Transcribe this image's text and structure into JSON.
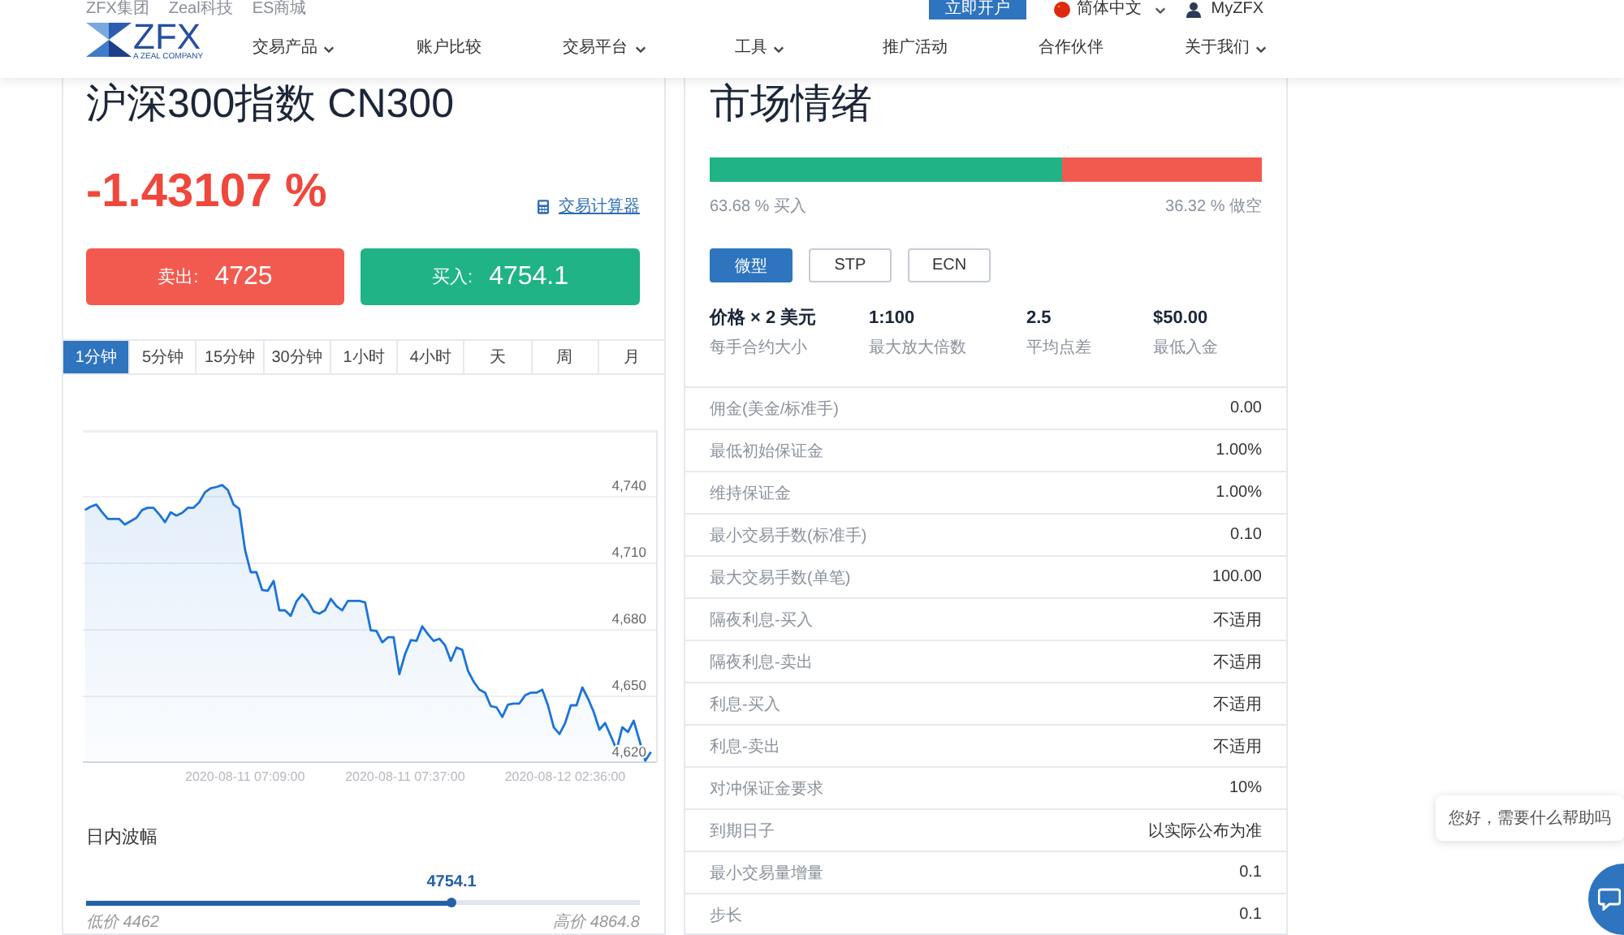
{
  "header": {
    "top_links": [
      "ZFX集团",
      "Zeal科技",
      "ES商城"
    ],
    "open_account_button": "立即开户",
    "language": "简体中文",
    "account_link": "MyZFX",
    "logo": {
      "text": "ZFX",
      "tagline": "A ZEAL COMPANY"
    },
    "nav": [
      {
        "label": "交易产品",
        "dropdown": true
      },
      {
        "label": "账户比较",
        "dropdown": false
      },
      {
        "label": "交易平台",
        "dropdown": true
      },
      {
        "label": "工具",
        "dropdown": true
      },
      {
        "label": "推广活动",
        "dropdown": false
      },
      {
        "label": "合作伙伴",
        "dropdown": false
      },
      {
        "label": "关于我们",
        "dropdown": true
      }
    ]
  },
  "instrument": {
    "title": "沪深300指数 CN300",
    "change": "-1.43107 %",
    "falling": true,
    "calculator_link": "交易计算器",
    "quotes": [
      {
        "kind": "sell",
        "label": "卖出:",
        "price": "4725"
      },
      {
        "kind": "buy",
        "label": "买入:",
        "price": "4754.1"
      }
    ],
    "timeframes": [
      {
        "label": "1分钟",
        "selected": true
      },
      {
        "label": "5分钟",
        "selected": false
      },
      {
        "label": "15分钟",
        "selected": false
      },
      {
        "label": "30分钟",
        "selected": false
      },
      {
        "label": "1小时",
        "selected": false
      },
      {
        "label": "4小时",
        "selected": false
      },
      {
        "label": "天",
        "selected": false
      },
      {
        "label": "周",
        "selected": false
      },
      {
        "label": "月",
        "selected": false
      }
    ],
    "chart_data": {
      "type": "area",
      "grid": true,
      "ylim": [
        4620,
        4770
      ],
      "yticks": [
        {
          "value": 4620,
          "label": "4,620"
        },
        {
          "value": 4650,
          "label": "4,650"
        },
        {
          "value": 4680,
          "label": "4,680"
        },
        {
          "value": 4710,
          "label": "4,710"
        },
        {
          "value": 4740,
          "label": "4,740"
        }
      ],
      "categories": [
        null,
        null,
        null,
        null,
        null,
        null,
        null,
        null,
        null,
        null,
        null,
        null,
        null,
        null,
        null,
        null,
        null,
        null,
        null,
        null,
        null,
        null,
        null,
        null,
        null,
        null,
        null,
        null,
        "2020-08-11 07:09:00",
        null,
        null,
        null,
        null,
        null,
        null,
        null,
        null,
        null,
        null,
        null,
        null,
        null,
        null,
        null,
        null,
        null,
        null,
        null,
        null,
        null,
        null,
        null,
        null,
        null,
        null,
        null,
        "2020-08-11 07:37:00",
        null,
        null,
        null,
        null,
        null,
        null,
        null,
        null,
        null,
        null,
        null,
        null,
        null,
        null,
        null,
        null,
        null,
        null,
        null,
        null,
        null,
        null,
        null,
        null,
        null,
        null,
        null,
        "2020-08-12 02:36:00",
        null,
        null,
        null,
        null,
        null,
        null,
        null,
        null,
        null,
        null,
        null,
        null,
        null,
        null,
        null
      ],
      "values": [
        4734,
        4735.5,
        4736.5,
        4733,
        4730,
        4730,
        4730,
        4727.5,
        4729,
        4730.5,
        4734,
        4735,
        4735,
        4732,
        4728.5,
        4733,
        4731.5,
        4732.7,
        4735,
        4735,
        4737.5,
        4742,
        4743.8,
        4744.4,
        4745.3,
        4743,
        4736.5,
        4734.6,
        4716,
        4706,
        4706,
        4698,
        4697.6,
        4702,
        4688.8,
        4688.8,
        4686.3,
        4692.7,
        4696,
        4693,
        4688.3,
        4687.3,
        4688.8,
        4694,
        4690.7,
        4688.8,
        4693,
        4693,
        4693,
        4692.4,
        4679.8,
        4679.5,
        4674.4,
        4676.6,
        4676.6,
        4660,
        4669,
        4675.4,
        4675,
        4681.5,
        4678,
        4675,
        4676,
        4673,
        4666,
        4672,
        4671,
        4661.5,
        4656.6,
        4653,
        4651.7,
        4645.6,
        4645,
        4640.7,
        4646.3,
        4646.8,
        4646.8,
        4650.5,
        4651.7,
        4651.7,
        4653,
        4646,
        4636,
        4633,
        4638,
        4646,
        4646,
        4654,
        4649,
        4643,
        4635,
        4638,
        4632,
        4626,
        4636,
        4634,
        4639,
        4630,
        4621,
        4625
      ]
    },
    "intraday_range": {
      "title": "日内波幅",
      "value": "4754.1",
      "level": 0.66,
      "low": "低价 4462",
      "high": "高价 4864.8"
    }
  },
  "sentiment": {
    "title": "市场情绪",
    "level": 0.6368,
    "buy_label": "63.68 % 买入",
    "short_label": "36.32 % 做空",
    "account_types": [
      {
        "label": "微型",
        "selected": true
      },
      {
        "label": "STP",
        "selected": false
      },
      {
        "label": "ECN",
        "selected": false
      }
    ],
    "key_stats": [
      {
        "value": "价格 × 2 美元",
        "label": "每手合约大小"
      },
      {
        "value": "1:100",
        "label": "最大放大倍数"
      },
      {
        "value": "2.5",
        "label": "平均点差"
      },
      {
        "value": "$50.00",
        "label": "最低入金"
      }
    ],
    "table": [
      {
        "name": "佣金(美金/标准手)",
        "value": "0.00"
      },
      {
        "name": "最低初始保证金",
        "value": "1.00%"
      },
      {
        "name": "维持保证金",
        "value": "1.00%"
      },
      {
        "name": "最小交易手数(标准手)",
        "value": "0.10"
      },
      {
        "name": "最大交易手数(单笔)",
        "value": "100.00"
      },
      {
        "name": "隔夜利息-买入",
        "value": "不适用"
      },
      {
        "name": "隔夜利息-卖出",
        "value": "不适用"
      },
      {
        "name": "利息-买入",
        "value": "不适用"
      },
      {
        "name": "利息-卖出",
        "value": "不适用"
      },
      {
        "name": "对冲保证金要求",
        "value": "10%"
      },
      {
        "name": "到期日子",
        "value": "以实际公布为准"
      },
      {
        "name": "最小交易量增量",
        "value": "0.1"
      },
      {
        "name": "步长",
        "value": "0.1"
      }
    ]
  },
  "chat": {
    "greeting": "您好，需要什么帮助吗"
  }
}
